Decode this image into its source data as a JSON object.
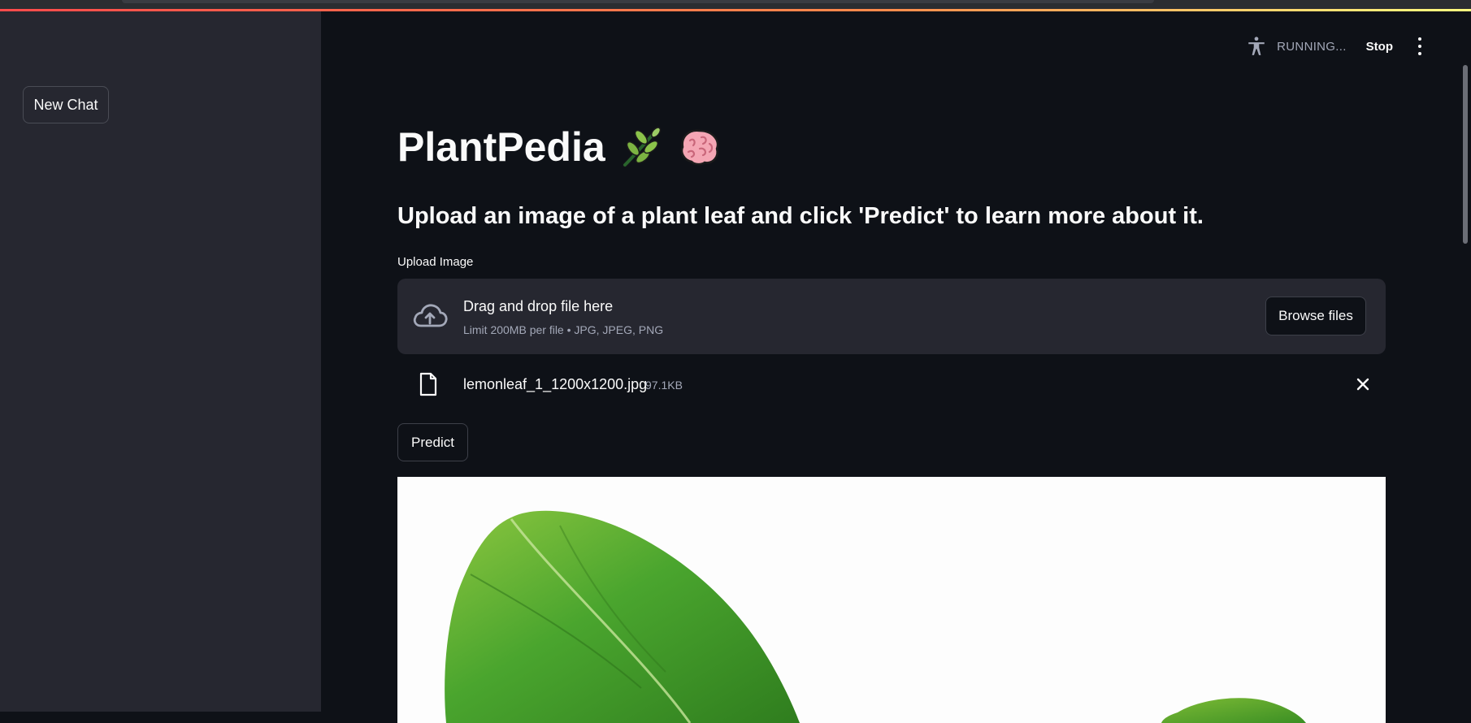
{
  "sidebar": {
    "new_chat_label": "New Chat"
  },
  "header": {
    "status_text": "RUNNING...",
    "stop_label": "Stop",
    "running_icon": "accessibility-running-icon",
    "menu_icon": "kebab-menu-icon"
  },
  "main": {
    "title": "PlantPedia",
    "title_emojis": [
      "herb-emoji",
      "brain-emoji"
    ],
    "subtitle": "Upload an image of a plant leaf and click 'Predict' to learn more about it.",
    "upload": {
      "label": "Upload Image",
      "drop_title": "Drag and drop file here",
      "drop_limits": "Limit 200MB per file • JPG, JPEG, PNG",
      "browse_label": "Browse files",
      "upload_icon": "cloud-upload-icon"
    },
    "file": {
      "name": "lemonleaf_1_1200x1200.jpg",
      "size": "97.1KB",
      "file_icon": "file-icon",
      "remove_icon": "close-icon"
    },
    "predict_label": "Predict",
    "image_subject": "green lemon leaf on white background"
  },
  "colors": {
    "background": "#0e1117",
    "sidebar": "#262730",
    "accent_gradient_start": "#ff4b4b",
    "accent_gradient_end": "#fffd80",
    "muted_text": "#a3a8b8"
  }
}
